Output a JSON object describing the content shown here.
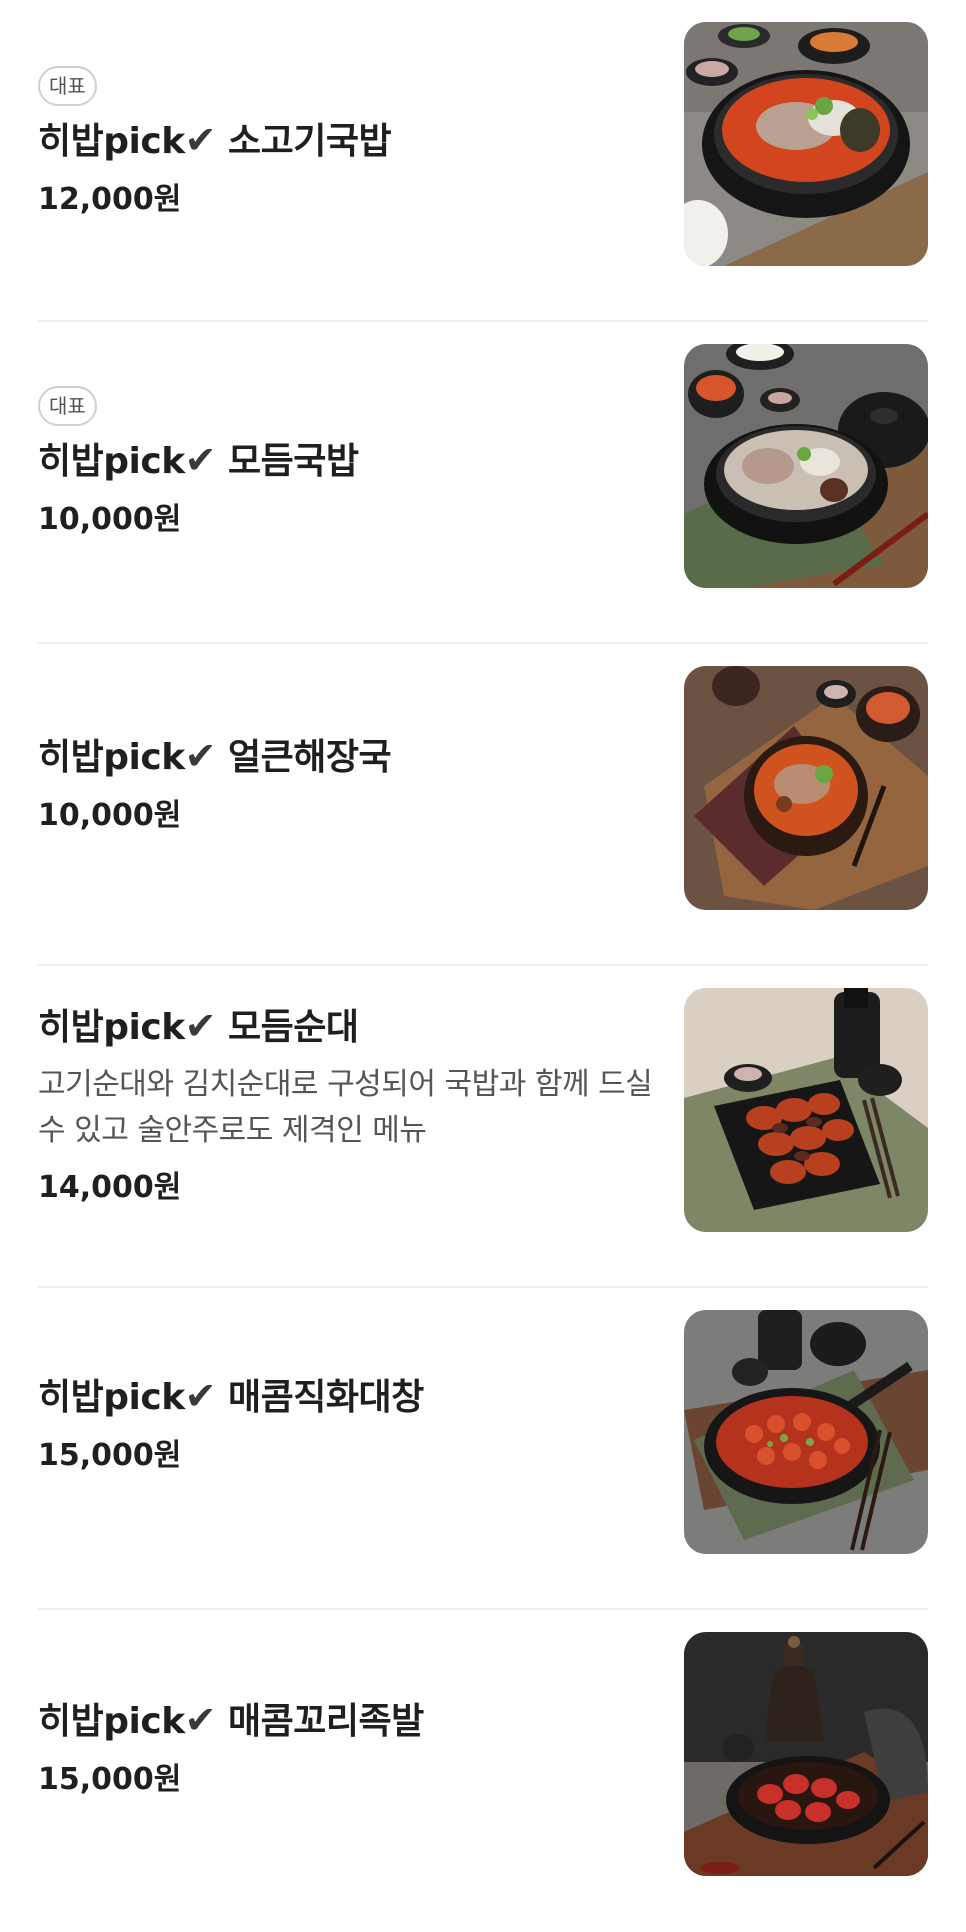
{
  "menu": {
    "items": [
      {
        "badge": "대표",
        "name_prefix": "히밥pick",
        "check": "✔",
        "name": "소고기국밥",
        "description": "",
        "price": "12,000원",
        "image_icon": "beef-soup-photo"
      },
      {
        "badge": "대표",
        "name_prefix": "히밥pick",
        "check": "✔",
        "name": "모듬국밥",
        "description": "",
        "price": "10,000원",
        "image_icon": "mixed-gukbap-photo"
      },
      {
        "badge": "",
        "name_prefix": "히밥pick",
        "check": "✔",
        "name": "얼큰해장국",
        "description": "",
        "price": "10,000원",
        "image_icon": "spicy-haejangguk-photo"
      },
      {
        "badge": "",
        "name_prefix": "히밥pick",
        "check": "✔",
        "name": "모듬순대",
        "description": "고기순대와 김치순대로 구성되어 국밥과 함께 드실수 있고 술안주로도 제격인 메뉴",
        "price": "14,000원",
        "image_icon": "assorted-sundae-photo"
      },
      {
        "badge": "",
        "name_prefix": "히밥pick",
        "check": "✔",
        "name": "매콤직화대창",
        "description": "",
        "price": "15,000원",
        "image_icon": "spicy-grilled-daechang-photo"
      },
      {
        "badge": "",
        "name_prefix": "히밥pick",
        "check": "✔",
        "name": "매콤꼬리족발",
        "description": "",
        "price": "15,000원",
        "image_icon": "spicy-tail-jokbal-photo"
      }
    ]
  },
  "colors": {
    "text": "#1f1f1f",
    "description": "#555555",
    "divider": "#eeeeee",
    "badge_border": "#cfcfcf"
  }
}
